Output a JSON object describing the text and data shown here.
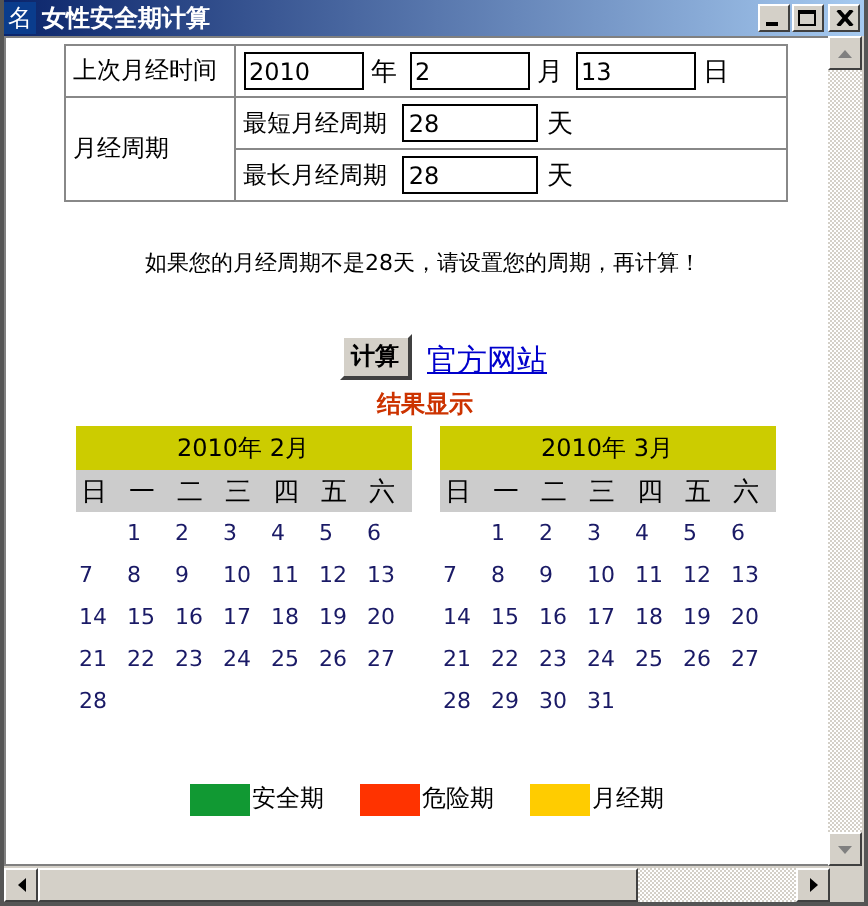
{
  "window": {
    "title": "女性安全期计算",
    "icon": "名"
  },
  "form": {
    "last_period": {
      "label": "上次月经时间",
      "fields": [
        {
          "value": "2010",
          "unit": "年"
        },
        {
          "value": "2",
          "unit": "月"
        },
        {
          "value": "13",
          "unit": "日"
        }
      ]
    },
    "cycle": {
      "label": "月经周期",
      "rows": [
        {
          "label": "最短月经周期",
          "value": "28",
          "unit": "天"
        },
        {
          "label": "最长月经周期",
          "value": "28",
          "unit": "天"
        }
      ]
    }
  },
  "note": "如果您的月经周期不是28天，请设置您的周期，再计算！",
  "calculate_button": "计算",
  "link": "官方网站",
  "result_title": "结果显示",
  "calendars": [
    {
      "title": "2010年 2月",
      "weekdays": [
        "日",
        "一",
        "二",
        "三",
        "四",
        "五",
        "六"
      ],
      "weeks": [
        [
          "1",
          "2",
          "3",
          "4",
          "5",
          "6"
        ],
        [
          "7",
          "8",
          "9",
          "10",
          "11",
          "12",
          "13"
        ],
        [
          "14",
          "15",
          "16",
          "17",
          "18",
          "19",
          "20"
        ],
        [
          "21",
          "22",
          "23",
          "24",
          "25",
          "26",
          "27"
        ],
        [
          "28"
        ]
      ]
    },
    {
      "title": "2010年 3月",
      "weekdays": [
        "日",
        "一",
        "二",
        "三",
        "四",
        "五",
        "六"
      ],
      "weeks": [
        [
          "1",
          "2",
          "3",
          "4",
          "5",
          "6"
        ],
        [
          "7",
          "8",
          "9",
          "10",
          "11",
          "12",
          "13"
        ],
        [
          "14",
          "15",
          "16",
          "17",
          "18",
          "19",
          "20"
        ],
        [
          "21",
          "22",
          "23",
          "24",
          "25",
          "26",
          "27"
        ],
        [
          "28",
          "29",
          "30",
          "31"
        ]
      ]
    }
  ],
  "legend": [
    {
      "label": "安全期",
      "color": "#119933"
    },
    {
      "label": "危险期",
      "color": "#ff3300"
    },
    {
      "label": "月经期",
      "color": "#ffcc00"
    }
  ]
}
